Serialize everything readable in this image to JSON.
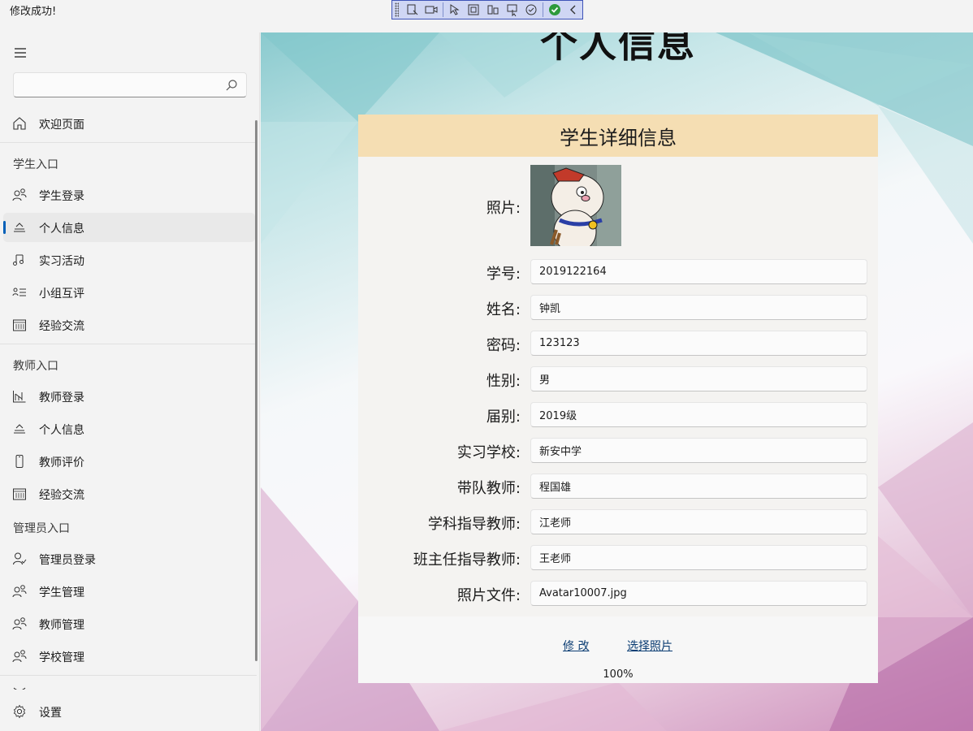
{
  "status_message": "修改成功!",
  "search": {
    "placeholder": "",
    "value": ""
  },
  "sidebar": {
    "items": [
      {
        "label": "欢迎页面",
        "icon": "home-icon"
      },
      {
        "label": "学生登录",
        "icon": "people-icon"
      },
      {
        "label": "个人信息",
        "icon": "info-icon",
        "selected": true
      },
      {
        "label": "实习活动",
        "icon": "music-icon"
      },
      {
        "label": "小组互评",
        "icon": "list-icon"
      },
      {
        "label": "经验交流",
        "icon": "calendar-icon"
      },
      {
        "label": "教师登录",
        "icon": "chart-icon"
      },
      {
        "label": "个人信息",
        "icon": "info-icon"
      },
      {
        "label": "教师评价",
        "icon": "phone-icon"
      },
      {
        "label": "经验交流",
        "icon": "calendar-icon"
      },
      {
        "label": "管理员登录",
        "icon": "admin-icon"
      },
      {
        "label": "学生管理",
        "icon": "people-icon"
      },
      {
        "label": "教师管理",
        "icon": "people-icon"
      },
      {
        "label": "学校管理",
        "icon": "people-icon"
      }
    ],
    "sections": [
      "学生入口",
      "教师入口",
      "管理员入口"
    ],
    "settings_label": "设置"
  },
  "page": {
    "title": "个人信息",
    "card_title": "学生详细信息",
    "photo_label": "照片:",
    "fields": [
      {
        "label": "学号:",
        "value": "2019122164"
      },
      {
        "label": "姓名:",
        "value": "钟凯"
      },
      {
        "label": "密码:",
        "value": "123123"
      },
      {
        "label": "性别:",
        "value": "男"
      },
      {
        "label": "届别:",
        "value": "2019级"
      },
      {
        "label": "实习学校:",
        "value": "新安中学"
      },
      {
        "label": "带队教师:",
        "value": "程国雄"
      },
      {
        "label": "学科指导教师:",
        "value": "江老师"
      },
      {
        "label": "班主任指导教师:",
        "value": "王老师"
      },
      {
        "label": "照片文件:",
        "value": "Avatar10007.jpg"
      }
    ],
    "modify_link": "修 改",
    "choose_photo_link": "选择照片",
    "zoom": "100%"
  },
  "colors": {
    "accent": "#005fb8",
    "card_header": "#f5deb3",
    "link": "#0b3d73"
  }
}
